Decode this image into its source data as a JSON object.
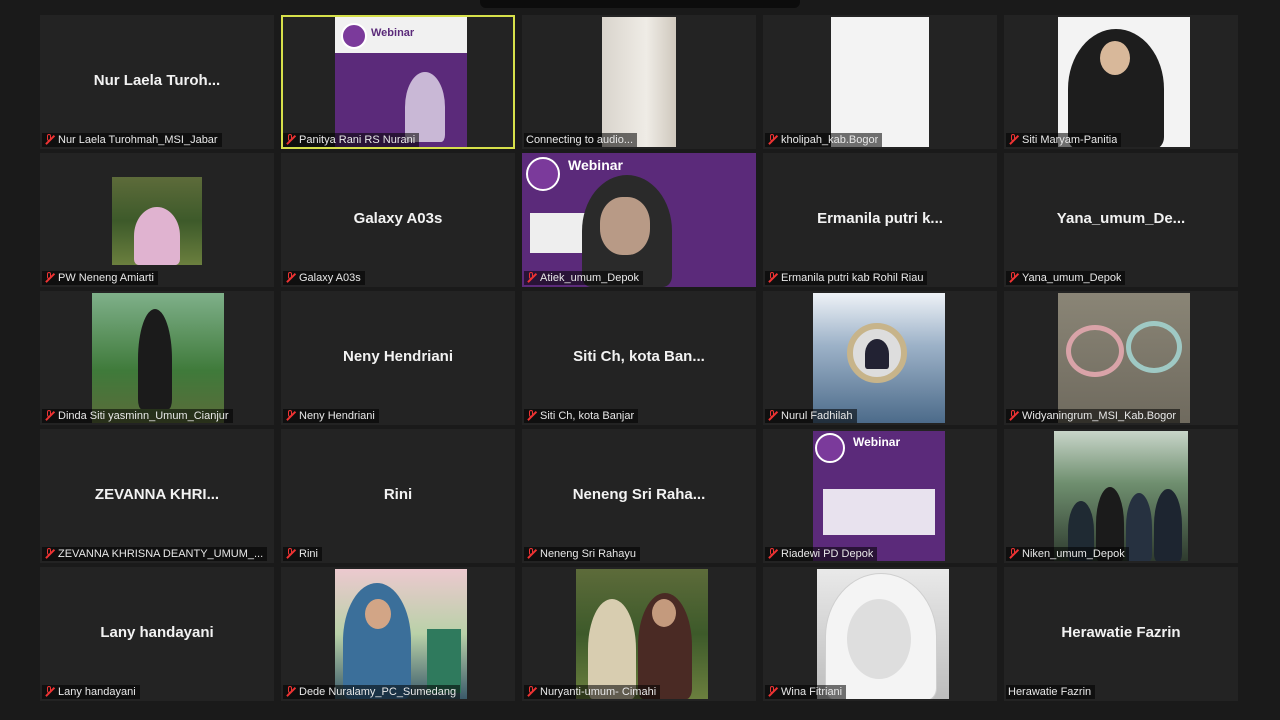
{
  "participants": [
    {
      "name_center": "Nur Laela Turoh...",
      "label": "Nur Laela Turohmah_MSI_Jabar"
    },
    {
      "name_center": "",
      "label": "Panitya Rani RS Nurani"
    },
    {
      "name_center": "",
      "label": "Connecting to audio..."
    },
    {
      "name_center": "",
      "label": "kholipah_kab.Bogor"
    },
    {
      "name_center": "",
      "label": "Siti Maryam-Panitia"
    },
    {
      "name_center": "",
      "label": "PW Neneng Amiarti"
    },
    {
      "name_center": "Galaxy A03s",
      "label": "Galaxy A03s"
    },
    {
      "name_center": "",
      "label": "Atiek_umum_Depok"
    },
    {
      "name_center": "Ermanila putri k...",
      "label": "Ermanila putri kab Rohil Riau"
    },
    {
      "name_center": "Yana_umum_De...",
      "label": "Yana_umum_Depok"
    },
    {
      "name_center": "",
      "label": "Dinda Siti yasminn_Umum_Cianjur"
    },
    {
      "name_center": "Neny Hendriani",
      "label": "Neny Hendriani"
    },
    {
      "name_center": "Siti Ch, kota Ban...",
      "label": "Siti Ch, kota Banjar"
    },
    {
      "name_center": "",
      "label": "Nurul Fadhilah"
    },
    {
      "name_center": "",
      "label": "Widyaningrum_MSI_Kab.Bogor"
    },
    {
      "name_center": "ZEVANNA KHRI...",
      "label": "ZEVANNA KHRISNA DEANTY_UMUM_..."
    },
    {
      "name_center": "Rini",
      "label": "Rini"
    },
    {
      "name_center": "Neneng Sri Raha...",
      "label": "Neneng Sri Rahayu"
    },
    {
      "name_center": "",
      "label": "Riadewi PD Depok"
    },
    {
      "name_center": "",
      "label": "Niken_umum_Depok"
    },
    {
      "name_center": "Lany handayani",
      "label": "Lany handayani"
    },
    {
      "name_center": "",
      "label": "Dede Nuralamy_PC_Sumedang"
    },
    {
      "name_center": "",
      "label": "Nuryanti-umum- Cimahi"
    },
    {
      "name_center": "",
      "label": "Wina Fitriani"
    },
    {
      "name_center": "Herawatie Fazrin",
      "label": "Herawatie Fazrin"
    }
  ],
  "slide": {
    "title": "Webinar"
  },
  "colors": {
    "active_border": "#d6e04a",
    "background": "#1a1a1a",
    "tile": "#232323",
    "muted_icon": "#e33333"
  }
}
